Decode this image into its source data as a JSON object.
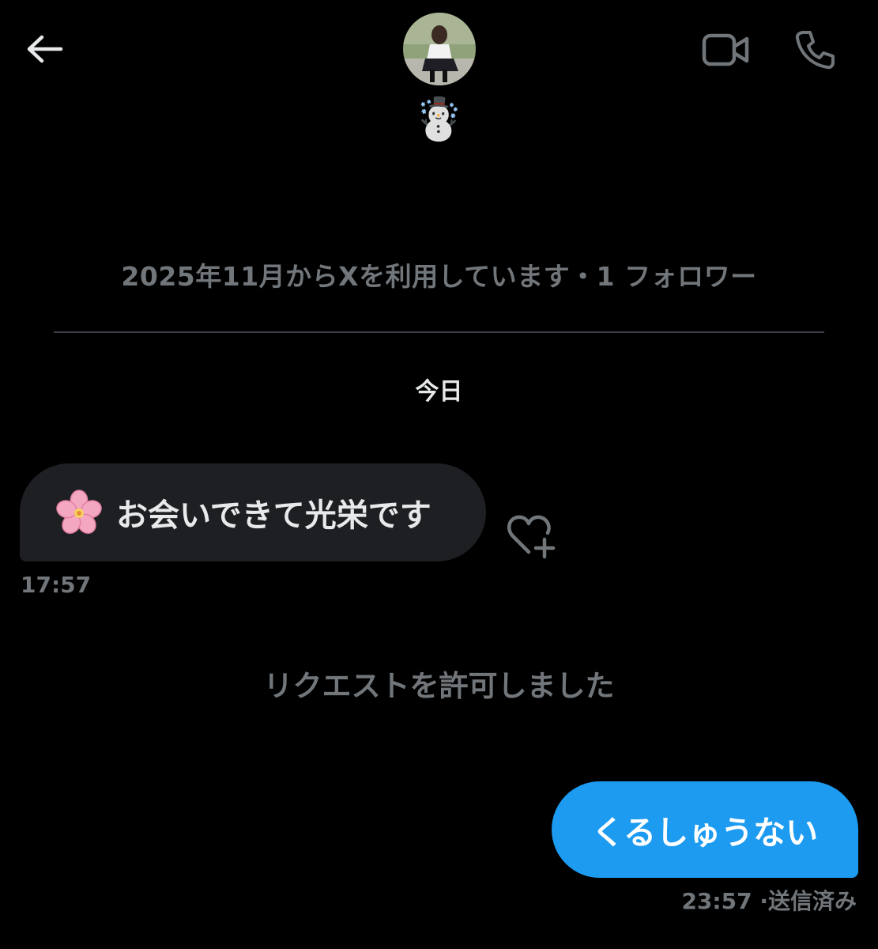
{
  "header": {
    "display_name": "☃️",
    "back_icon": "arrow-left-icon",
    "video_icon": "video-camera-icon",
    "call_icon": "phone-icon"
  },
  "profile": {
    "info": "2025年11月からXを利用しています・1 フォロワー"
  },
  "date_separator": "今日",
  "messages": [
    {
      "direction": "incoming",
      "text": "お会いできて光栄です",
      "emoji_icon": "cherry-blossom-icon",
      "time": "17:57"
    },
    {
      "direction": "system",
      "text": "リクエストを許可しました"
    },
    {
      "direction": "outgoing",
      "text": "くるしゅうない",
      "time": "23:57",
      "status": "送信済み"
    }
  ],
  "colors": {
    "background": "#000000",
    "incoming_bubble": "#1d1f23",
    "outgoing_bubble": "#1d9bf0",
    "muted_text": "#71767b"
  }
}
